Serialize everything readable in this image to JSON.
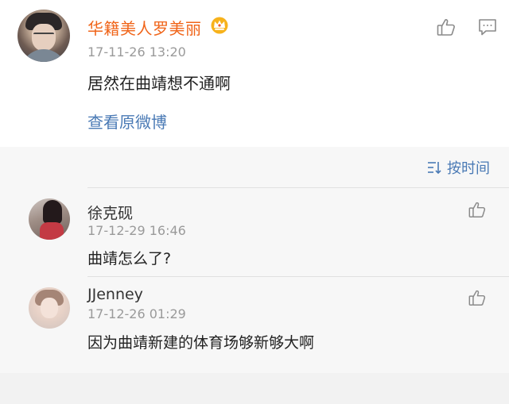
{
  "post": {
    "username": "华籍美人罗美丽",
    "timestamp": "17-11-26 13:20",
    "text": "居然在曲靖想不通啊",
    "view_original": "查看原微博"
  },
  "sort": {
    "label": "按时间"
  },
  "comments": [
    {
      "username": "徐克砚",
      "timestamp": "17-12-29 16:46",
      "text": "曲靖怎么了?"
    },
    {
      "username": "JJenney",
      "timestamp": "17-12-26 01:29",
      "text": "因为曲靖新建的体育场够新够大啊"
    }
  ],
  "colors": {
    "username_orange": "#f0651a",
    "link_blue": "#4a7ab5",
    "timestamp_gray": "#9a9a9a"
  },
  "icons": {
    "like": "thumbs-up-icon",
    "comment": "comment-bubble-icon",
    "badge": "crown-badge-icon",
    "sort": "sort-icon"
  }
}
